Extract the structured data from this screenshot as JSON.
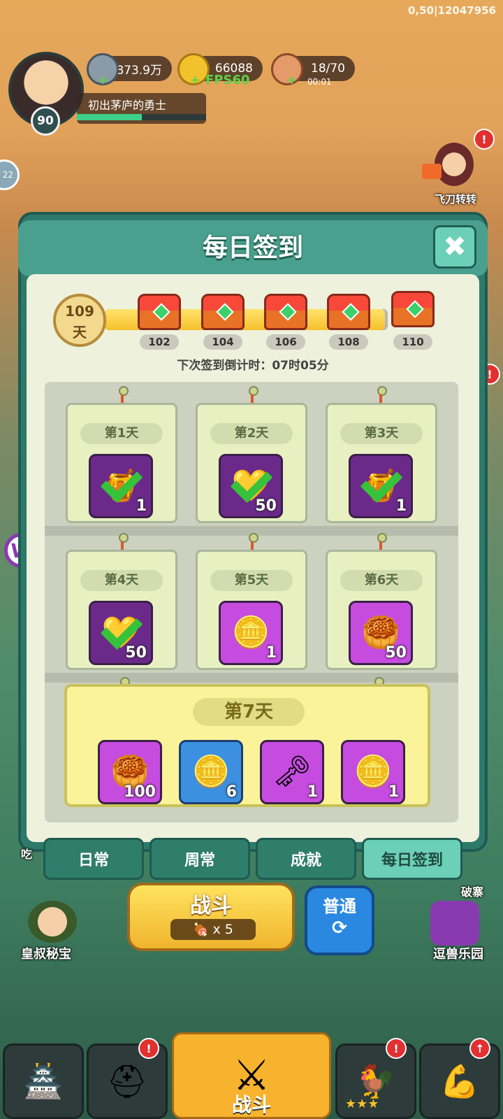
{
  "debug_text": "0,50|12047956",
  "player": {
    "level": "90",
    "title": "初出茅庐的勇士",
    "xp_fraction": 0.5
  },
  "resources": {
    "silver": "1873.9万",
    "gold": "66088",
    "fps": "FPS60",
    "stamina": "18/70",
    "stamina_timer": "00:01",
    "plus": "+"
  },
  "side": {
    "left_badge": "22",
    "feidao": "飞刀转转",
    "left_bottom_label": "皇叔秘宝",
    "right_bottom_label": "逗兽乐园",
    "left_partial": "吃",
    "right_partial": "破寨",
    "badge_mark": "!"
  },
  "dialog": {
    "title": "每日签到",
    "close_icon": "close-icon",
    "days_total": "109",
    "days_unit": "天",
    "progress_fraction": 0.99,
    "milestones": [
      "102",
      "104",
      "106",
      "108",
      "110"
    ],
    "countdown": "下次签到倒计时：07时05分",
    "days": [
      {
        "label": "第1天",
        "qty": "1",
        "claimed": true,
        "icon": "jar-icon"
      },
      {
        "label": "第2天",
        "qty": "50",
        "claimed": true,
        "icon": "heart-icon"
      },
      {
        "label": "第3天",
        "qty": "1",
        "claimed": true,
        "icon": "jar-icon"
      },
      {
        "label": "第4天",
        "qty": "50",
        "claimed": true,
        "icon": "heart-icon"
      },
      {
        "label": "第5天",
        "qty": "1",
        "claimed": false,
        "icon": "heart-coin-icon"
      },
      {
        "label": "第6天",
        "qty": "50",
        "claimed": false,
        "icon": "gold-ingot-icon"
      }
    ],
    "day7": {
      "label": "第7天",
      "items": [
        {
          "qty": "100",
          "icon": "gold-ingot-icon"
        },
        {
          "qty": "6",
          "icon": "silver-coin-icon"
        },
        {
          "qty": "1",
          "icon": "key-icon"
        },
        {
          "qty": "1",
          "icon": "heart-coin-icon"
        }
      ]
    }
  },
  "tabs": [
    "日常",
    "周常",
    "成就",
    "每日签到"
  ],
  "active_tab": 3,
  "battle": {
    "label": "战斗",
    "cost": "x 5",
    "mode": "普通",
    "mode_icon": "refresh-icon"
  },
  "nav": {
    "center_label": "战斗",
    "items": [
      "castle-icon",
      "helmet-icon",
      "swords-icon",
      "hero-stars-icon",
      "upgrade-icon"
    ],
    "stars": "★★★"
  }
}
